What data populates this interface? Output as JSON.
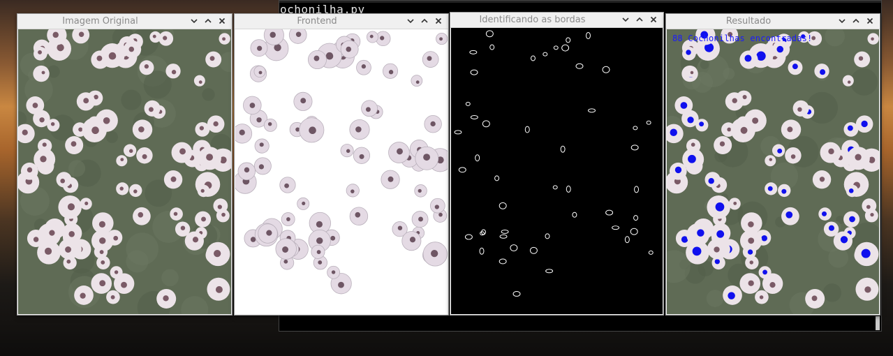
{
  "terminal": {
    "visible_text": "ochonilha.py"
  },
  "windows": [
    {
      "title": "Imagem Original",
      "controls": [
        "chevron-down-icon",
        "chevron-up-icon",
        "close-icon"
      ]
    },
    {
      "title": "Frontend",
      "controls": [
        "chevron-down-icon",
        "chevron-up-icon",
        "close-icon"
      ]
    },
    {
      "title": "Identificando as bordas",
      "controls": [
        "chevron-down-icon",
        "chevron-up-icon",
        "close-icon"
      ]
    },
    {
      "title": "Resultado",
      "controls": [
        "chevron-down-icon",
        "chevron-up-icon",
        "close-icon"
      ]
    }
  ],
  "result": {
    "message": "88 Cochonilhas encontradas!",
    "message_color": "#1a1aff"
  },
  "colors": {
    "leaf_green": "#5f6b55",
    "insect_white": "#ece3e8",
    "insect_center": "#7a5a66",
    "edge_white": "#ffffff",
    "marker_blue": "#1010ee"
  }
}
